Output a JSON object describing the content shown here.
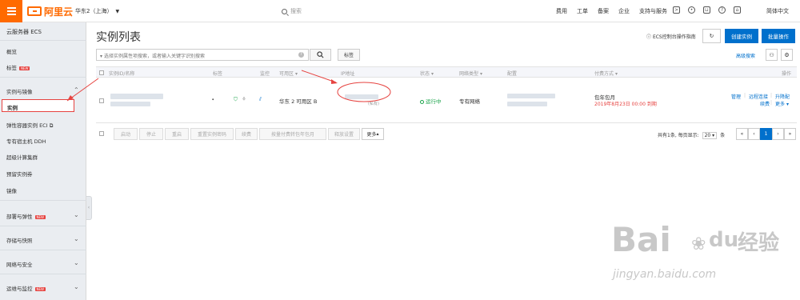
{
  "topbar": {
    "brand": "阿里云",
    "region": "华东2（上海）",
    "search_placeholder": "搜索",
    "nav": [
      "费用",
      "工单",
      "备案",
      "企业",
      "支持与服务"
    ],
    "lang": "简体中文"
  },
  "sidebar": {
    "title": "云服务器 ECS",
    "items_top": [
      "概览",
      "标签"
    ],
    "section_instances": "实例与镜像",
    "instances_items": [
      "实例",
      "弹性容器实例 ECI",
      "专有宿主机 DDH",
      "超级计算集群",
      "预留实例券",
      "镜像"
    ],
    "sections": [
      "部署与弹性",
      "存储与快照",
      "网络与安全",
      "运维与监控"
    ],
    "new_label": "NEW",
    "new_on": [
      "标签",
      "部署与弹性",
      "运维与监控"
    ]
  },
  "main": {
    "title": "实例列表",
    "guide_label": "ECS控制台操作指南",
    "create_label": "创建实例",
    "batch_label": "批量操作",
    "filter_placeholder": "选择实例属性项搜索，或者输入关键字识别搜索",
    "tag_label": "标签",
    "advanced_search": "高级搜索"
  },
  "table": {
    "headers": [
      "实例ID/名称",
      "标签",
      "监控",
      "可用区",
      "IP地址",
      "状态",
      "网络类型",
      "配置",
      "付费方式",
      "操作"
    ],
    "row": {
      "zone": "华东 2 可用区 B",
      "ip_suffix": "(私有)",
      "status": "运行中",
      "network": "专有网络",
      "billing": "包年包月",
      "expiry": "2019年8月23日 00:00 到期",
      "actions": [
        "管理",
        "远程连接",
        "升降配",
        "续费",
        "更多"
      ]
    }
  },
  "footer": {
    "buttons": [
      "启动",
      "停止",
      "重启",
      "重置实例密码",
      "续费",
      "按量付费转包年包月",
      "释放设置"
    ],
    "more": "更多",
    "page_info_prefix": "共有1条, 每页显示:",
    "page_size": "20",
    "page_info_suffix": "条",
    "current_page": "1"
  },
  "watermark": {
    "brand": "Bai",
    "brand_mid": "du",
    "cn": "经验",
    "url": "jingyan.baidu.com"
  },
  "colors": {
    "brand": "#ff6a00",
    "primary": "#0070cc",
    "danger": "#e64340",
    "success": "#1aa34a"
  }
}
